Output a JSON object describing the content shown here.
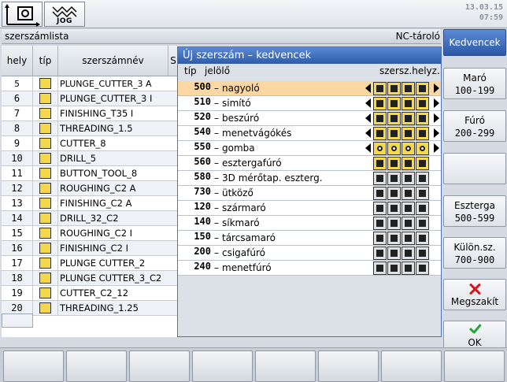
{
  "header": {
    "mode_jog_label": "JOG",
    "date": "13.03.15",
    "time": "07:59"
  },
  "list": {
    "title": "szerszámlista",
    "storage": "NC-tároló",
    "columns": {
      "place": "hely",
      "type": "típ",
      "name": "szerszámnév",
      "extra": "S"
    },
    "rows": [
      {
        "place": "5",
        "name": "PLUNGE_CUTTER_3 A"
      },
      {
        "place": "6",
        "name": "PLUNGE_CUTTER_3 I"
      },
      {
        "place": "7",
        "name": "FINISHING_T35 I"
      },
      {
        "place": "8",
        "name": "THREADING_1.5"
      },
      {
        "place": "9",
        "name": "CUTTER_8"
      },
      {
        "place": "10",
        "name": "DRILL_5"
      },
      {
        "place": "11",
        "name": "BUTTON_TOOL_8"
      },
      {
        "place": "12",
        "name": "ROUGHING_C2 A"
      },
      {
        "place": "13",
        "name": "FINISHING_C2 A"
      },
      {
        "place": "14",
        "name": "DRILL_32_C2"
      },
      {
        "place": "15",
        "name": "ROUGHING_C2 I"
      },
      {
        "place": "16",
        "name": "FINISHING_C2 I"
      },
      {
        "place": "17",
        "name": "PLUNGE CUTTER_2"
      },
      {
        "place": "18",
        "name": "PLUNGE CUTTER_3_C2"
      },
      {
        "place": "19",
        "name": "CUTTER_C2_12"
      },
      {
        "place": "20",
        "name": "THREADING_1.25"
      }
    ]
  },
  "popup": {
    "title": "Új szerszám – kedvencek",
    "columns": {
      "type": "típ",
      "name": "jelölő",
      "position": "szersz.helyz."
    },
    "selected_index": 0,
    "rows": [
      {
        "type": "500",
        "name": "nagyoló",
        "icons": "yellow",
        "arrows": true
      },
      {
        "type": "510",
        "name": "simító",
        "icons": "yellow",
        "arrows": true
      },
      {
        "type": "520",
        "name": "beszúró",
        "icons": "yellow",
        "arrows": true
      },
      {
        "type": "540",
        "name": "menetvágókés",
        "icons": "yellow",
        "arrows": true
      },
      {
        "type": "550",
        "name": "gomba",
        "icons": "yellow",
        "arrows": true
      },
      {
        "type": "560",
        "name": "esztergafúró",
        "icons": "yellow",
        "arrows": false
      },
      {
        "type": "580",
        "name": "3D mérőtap. eszterg.",
        "icons": "grey",
        "arrows": false
      },
      {
        "type": "730",
        "name": "ütköző",
        "icons": "grey",
        "arrows": false
      },
      {
        "type": "120",
        "name": "szármaró",
        "icons": "grey",
        "arrows": false
      },
      {
        "type": "140",
        "name": "síkmaró",
        "icons": "grey",
        "arrows": false
      },
      {
        "type": "150",
        "name": "tárcsamaró",
        "icons": "grey",
        "arrows": false
      },
      {
        "type": "200",
        "name": "csigafúró",
        "icons": "grey",
        "arrows": false
      },
      {
        "type": "240",
        "name": "menetfúró",
        "icons": "grey",
        "arrows": false
      }
    ]
  },
  "softkeys": {
    "favorites": "Kedvencek",
    "mill_label": "Maró",
    "mill_range": "100-199",
    "drill_label": "Fúró",
    "drill_range": "200-299",
    "turn_label": "Eszterga",
    "turn_range": "500-599",
    "special_label": "Külön.sz.",
    "special_range": "700-900",
    "cancel": "Megszakít",
    "ok": "OK"
  },
  "colors": {
    "accent": "#2f5ba8",
    "selection": "#fbd8a3",
    "tool_icon": "#f5d94a",
    "cancel": "#d4161b",
    "ok": "#22a63a"
  }
}
